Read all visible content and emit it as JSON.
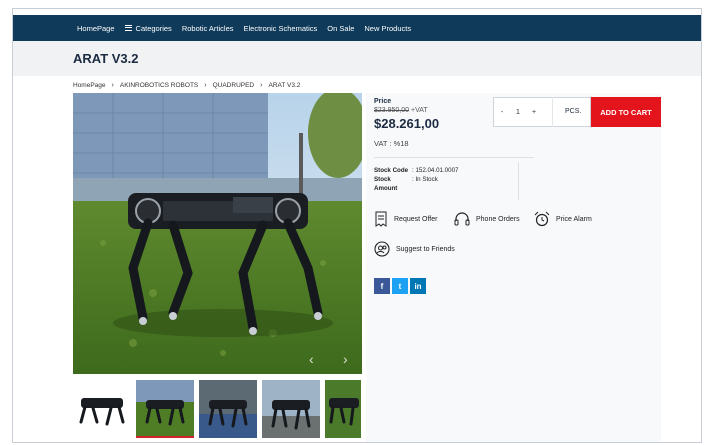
{
  "nav": {
    "items": [
      "HomePage",
      "Categories",
      "Robotic Articles",
      "Electronic Schematics",
      "On Sale",
      "New Products"
    ]
  },
  "page_title": "ARAT V3.2",
  "breadcrumb": [
    "HomePage",
    "AKINROBOTICS ROBOTS",
    "QUADRUPED",
    "ARAT V3.2"
  ],
  "product": {
    "price_label": "Price",
    "old_price": "$23.950,00",
    "old_price_suffix": "+VAT",
    "price": "$28.261,00",
    "vat": "VAT : %18",
    "qty_minus": "-",
    "qty_value": "1",
    "qty_plus": "+",
    "unit": "PCS.",
    "add_to_cart": "ADD TO CART",
    "stock_code_label": "Stock Code",
    "stock_code": ": 152.04.01.0007",
    "stock_label": "Stock",
    "stock_value": ": In Stock",
    "amount_label": "Amount"
  },
  "actions": {
    "request_offer": "Request Offer",
    "phone_orders": "Phone Orders",
    "price_alarm": "Price Alarm",
    "suggest": "Suggest to Friends"
  },
  "social": [
    "f",
    "t",
    "in"
  ],
  "gallery": {
    "prev_icon": "chevron-left-icon",
    "next_icon": "chevron-right-icon"
  },
  "colors": {
    "nav_bg": "#0f3a5a",
    "cart_button": "#e3141b",
    "facebook": "#3b5998",
    "twitter": "#1da1f2",
    "linkedin": "#0077b5"
  }
}
